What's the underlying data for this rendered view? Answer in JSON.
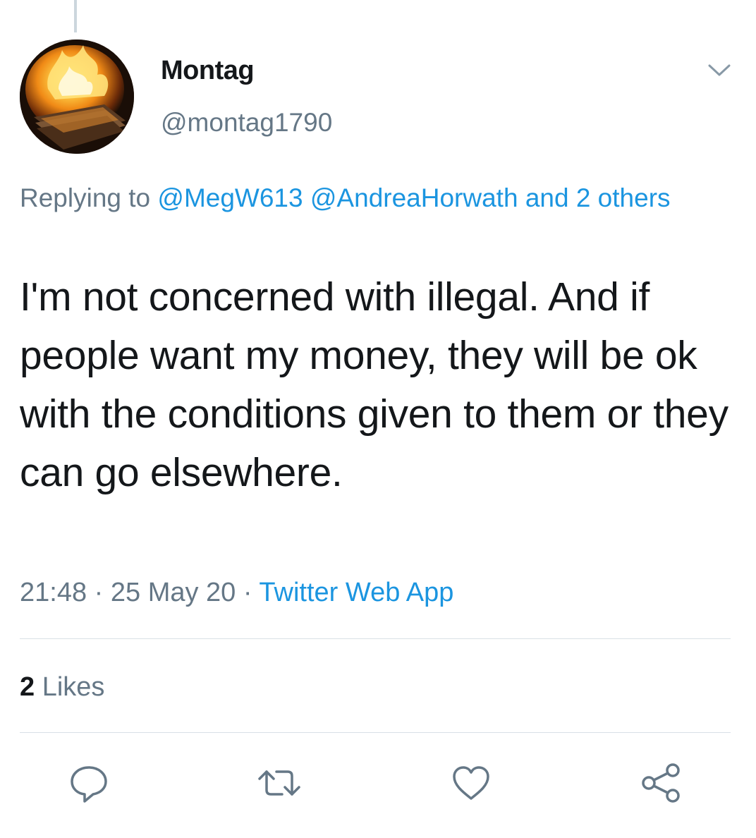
{
  "tweet": {
    "author": {
      "display_name": "Montag",
      "handle": "@montag1790",
      "avatar_icon": "burning-books-avatar"
    },
    "reply_context": {
      "prefix": "Replying to",
      "mention_1": "@MegW613",
      "mention_2": "@AndreaHorwath",
      "suffix": "and 2 others"
    },
    "text": "I'm not concerned with illegal. And if people want my money, they will be ok with the conditions given to them or they can go elsewhere.",
    "meta": {
      "time": "21:48",
      "separator_1": "·",
      "date": "25 May 20",
      "separator_2": "·",
      "source": "Twitter Web App"
    },
    "stats": {
      "likes_count": "2",
      "likes_label": "Likes"
    },
    "actions": [
      "reply-icon",
      "retweet-icon",
      "like-icon",
      "share-icon"
    ]
  },
  "colors": {
    "text": "#14171a",
    "secondary": "#657786",
    "link": "#1b95e0",
    "divider": "#d9e0e6",
    "icon": "#657786"
  }
}
